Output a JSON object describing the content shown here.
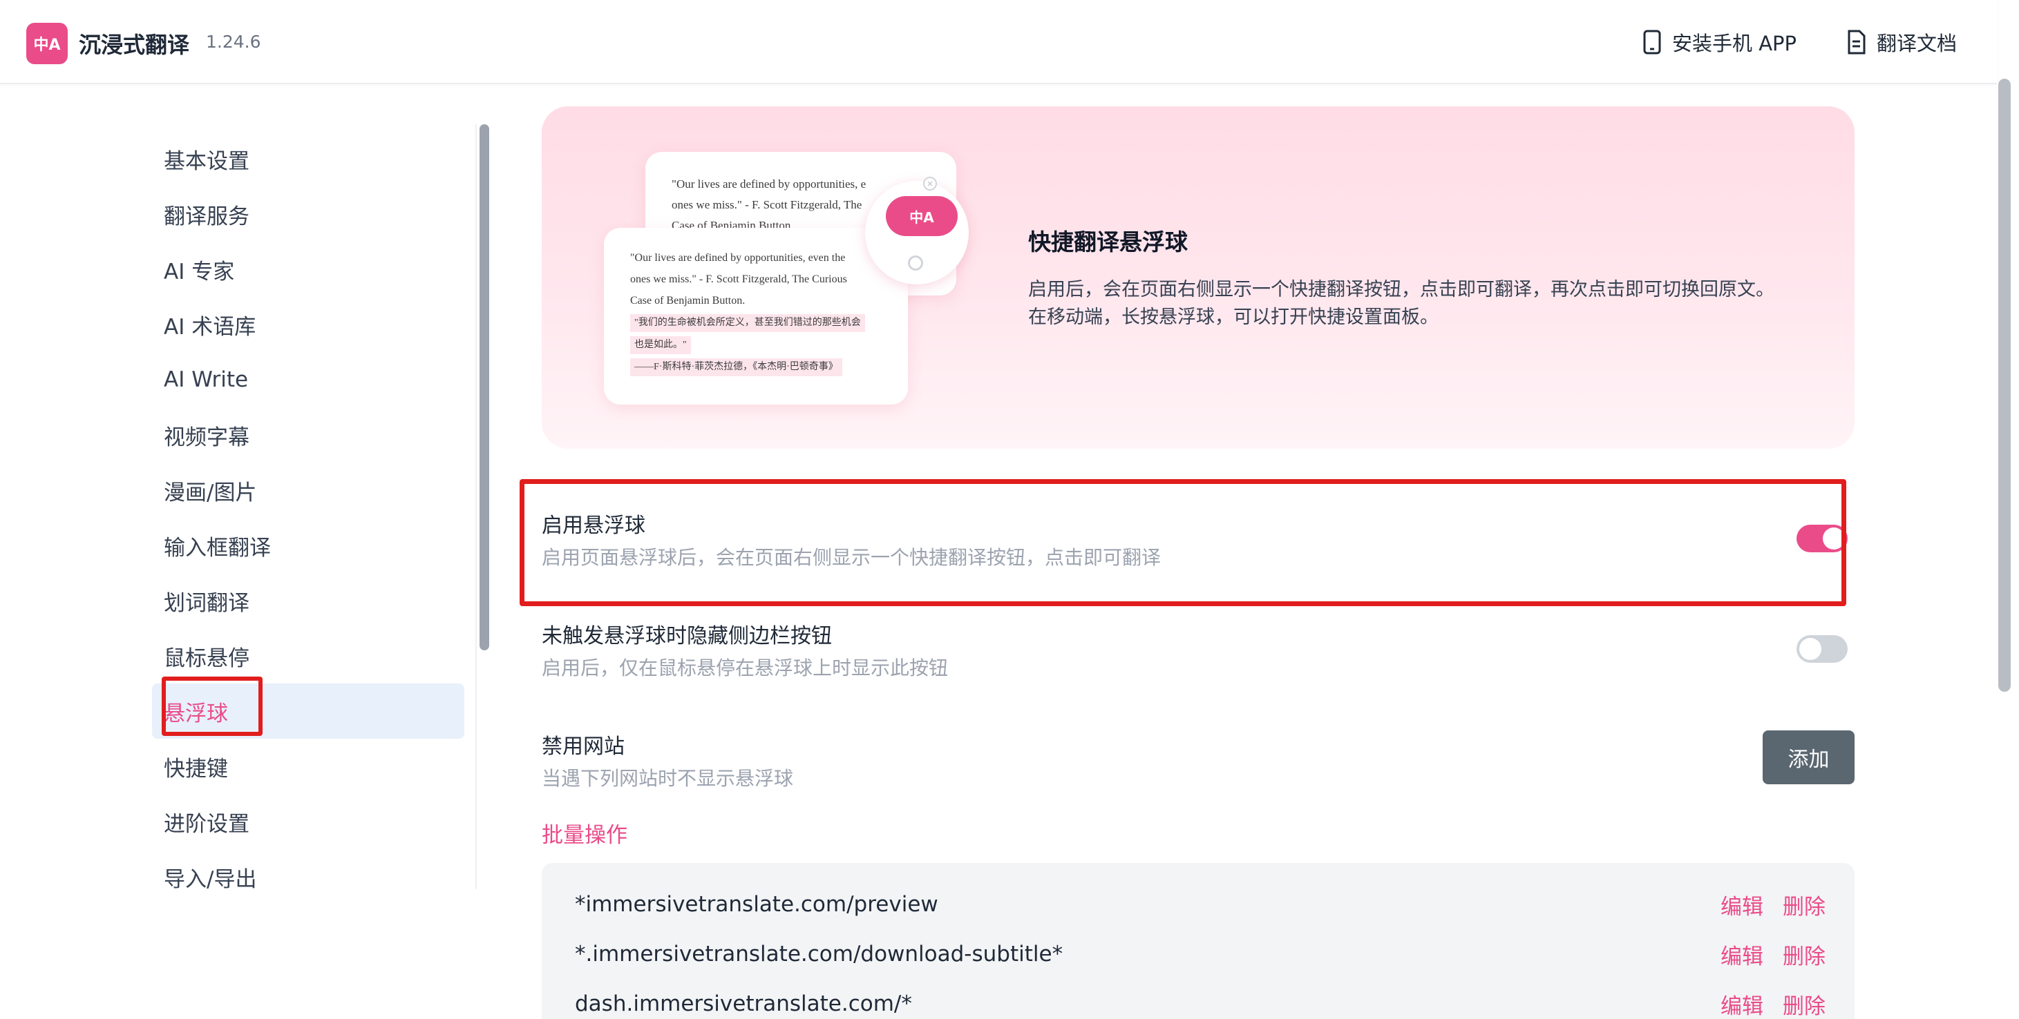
{
  "header": {
    "logo_text": "中A",
    "app_name": "沉浸式翻译",
    "version": "1.24.6",
    "install_app": "安装手机 APP",
    "docs": "翻译文档"
  },
  "sidebar": {
    "items": [
      {
        "label": "基本设置"
      },
      {
        "label": "翻译服务"
      },
      {
        "label": "AI 专家"
      },
      {
        "label": "AI 术语库"
      },
      {
        "label": "AI Write"
      },
      {
        "label": "视频字幕"
      },
      {
        "label": "漫画/图片"
      },
      {
        "label": "输入框翻译"
      },
      {
        "label": "划词翻译"
      },
      {
        "label": "鼠标悬停"
      },
      {
        "label": "悬浮球"
      },
      {
        "label": "快捷键"
      },
      {
        "label": "进阶设置"
      },
      {
        "label": "导入/导出"
      }
    ],
    "active_index": 10
  },
  "banner": {
    "title": "快捷翻译悬浮球",
    "desc_line1": "启用后，会在页面右侧显示一个快捷翻译按钮，点击即可翻译，再次点击即可切换回原文。",
    "desc_line2": "在移动端，长按悬浮球，可以打开快捷设置面板。",
    "illustration": {
      "back_lines": [
        "\"Our lives are defined by opportunities, e",
        "ones we miss.\" - F. Scott Fitzgerald, The",
        "Case of Benjamin Button."
      ],
      "front_lines": [
        "\"Our lives are defined by opportunities, even the",
        "ones we miss.\" - F. Scott Fitzgerald, The Curious",
        "Case of Benjamin Button."
      ],
      "front_zh": [
        "\"我们的生命被机会所定义，甚至我们错过的那些机会",
        "也是如此。\"",
        "——F·斯科特·菲茨杰拉德，《本杰明·巴顿奇事》"
      ],
      "ball_text": "中A"
    }
  },
  "settings": {
    "enable_ball": {
      "title": "启用悬浮球",
      "desc": "启用页面悬浮球后，会在页面右侧显示一个快捷翻译按钮，点击即可翻译",
      "enabled": true
    },
    "hide_sidebar_btn": {
      "title": "未触发悬浮球时隐藏侧边栏按钮",
      "desc": "启用后，仅在鼠标悬停在悬浮球上时显示此按钮",
      "enabled": false
    },
    "disabled_sites": {
      "title": "禁用网站",
      "desc": "当遇下列网站时不显示悬浮球",
      "add_label": "添加",
      "batch_label": "批量操作",
      "sites": [
        {
          "url": "*immersivetranslate.com/preview",
          "edit": "编辑",
          "delete": "删除"
        },
        {
          "url": "*.immersivetranslate.com/download-subtitle*",
          "edit": "编辑",
          "delete": "删除"
        },
        {
          "url": "dash.immersivetranslate.com/*",
          "edit": "编辑",
          "delete": "删除"
        }
      ]
    }
  },
  "colors": {
    "accent": "#ea4c89",
    "highlight_box": "#e11d1d",
    "active_bg": "#e8f0fb"
  }
}
